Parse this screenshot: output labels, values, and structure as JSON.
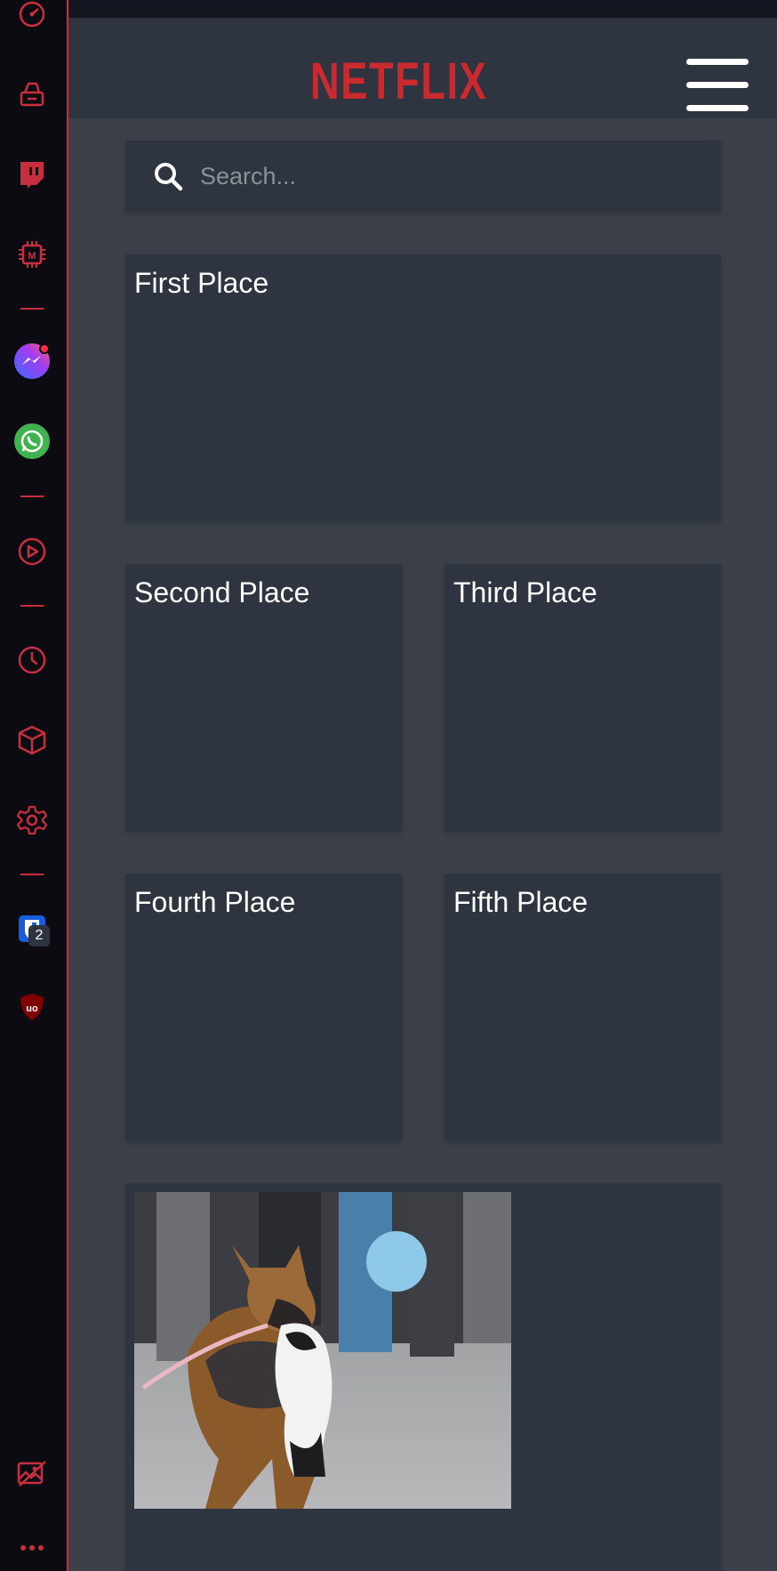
{
  "sidebar": {
    "items": [
      {
        "name": "speed-dial-icon"
      },
      {
        "name": "clean-brush-icon"
      },
      {
        "name": "twitch-icon"
      },
      {
        "name": "memory-chip-icon"
      },
      {
        "name": "messenger-icon"
      },
      {
        "name": "whatsapp-icon"
      },
      {
        "name": "player-icon"
      },
      {
        "name": "history-icon"
      },
      {
        "name": "extensions-cube-icon"
      },
      {
        "name": "settings-gear-icon"
      },
      {
        "name": "bitwarden-icon",
        "badge": "2"
      },
      {
        "name": "ublock-origin-icon"
      },
      {
        "name": "wallpaper-icon"
      },
      {
        "name": "more-dots-icon"
      }
    ],
    "accent": "#c72f3e"
  },
  "header": {
    "logo": "NETFLIX",
    "logo_color": "#c9292f"
  },
  "search": {
    "placeholder": "Search..."
  },
  "cards": {
    "first": "First Place",
    "second": "Second Place",
    "third": "Third Place",
    "fourth": "Fourth Place",
    "fifth": "Fifth Place"
  },
  "photo": {
    "subject": "german shepherd carrying a cat"
  }
}
